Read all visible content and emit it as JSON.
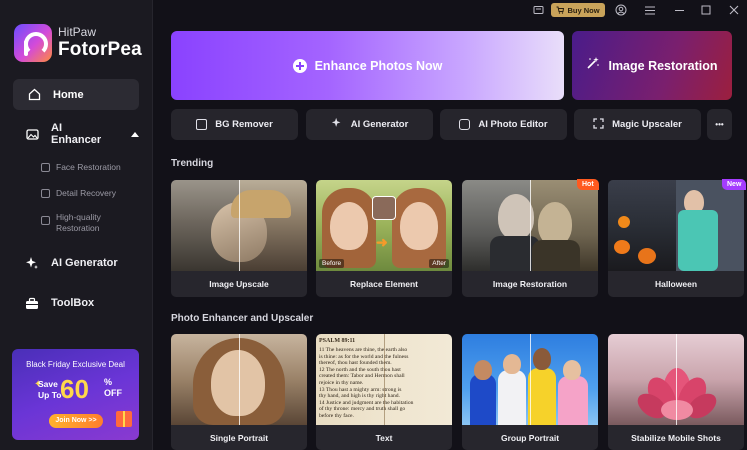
{
  "app": {
    "brand_small": "HitPaw",
    "brand_big": "FotorPea"
  },
  "sidebar": {
    "home": "Home",
    "ai_enhancer": "AI Enhancer",
    "sub_items": [
      "Face Restoration",
      "Detail Recovery",
      "High-quality\nRestoration"
    ],
    "ai_generator": "AI Generator",
    "toolbox": "ToolBox"
  },
  "promo": {
    "title": "Black Friday Exclusive Deal",
    "save": "Save",
    "upto": "Up To",
    "number": "60",
    "pct": "%",
    "off": "OFF",
    "join": "Join Now >>"
  },
  "topbar": {
    "buy_label": "Buy Now"
  },
  "hero": {
    "main": "Enhance Photos Now",
    "side": "Image Restoration"
  },
  "tools": [
    "BG Remover",
    "AI Generator",
    "AI Photo Editor",
    "Magic Upscaler",
    "•••"
  ],
  "sections": {
    "trending": "Trending",
    "photo": "Photo Enhancer and Upscaler"
  },
  "trending_cards": [
    {
      "caption": "Image Upscale"
    },
    {
      "caption": "Replace Element",
      "before": "Before",
      "after": "After"
    },
    {
      "caption": "Image Restoration",
      "badge": "Hot"
    },
    {
      "caption": "Halloween",
      "badge": "New"
    }
  ],
  "photo_cards": [
    {
      "caption": "Single Portrait"
    },
    {
      "caption": "Text",
      "psalm": "PSALM 89:11",
      "lines": [
        "11 The heavens are thine, the earth also",
        "is thine: as for the world and the fulness",
        "thereof, thou hast founded them.",
        "12 The north and the south thou hast",
        "created them: Tabor and Hermon shall",
        "rejoice in thy name.",
        "13 Thou hast a mighty arm: strong is",
        "thy hand, and high is thy right hand.",
        "14 Justice and judgment are the habitation",
        "of thy throne: mercy and truth shall go",
        "before thy face."
      ]
    },
    {
      "caption": "Group Portrait"
    },
    {
      "caption": "Stabilize Mobile Shots"
    }
  ],
  "colors": {
    "accent": "#8a42ff",
    "hot": "#ff5a1f",
    "new": "#a53cff",
    "gold": "#c9a35a"
  }
}
